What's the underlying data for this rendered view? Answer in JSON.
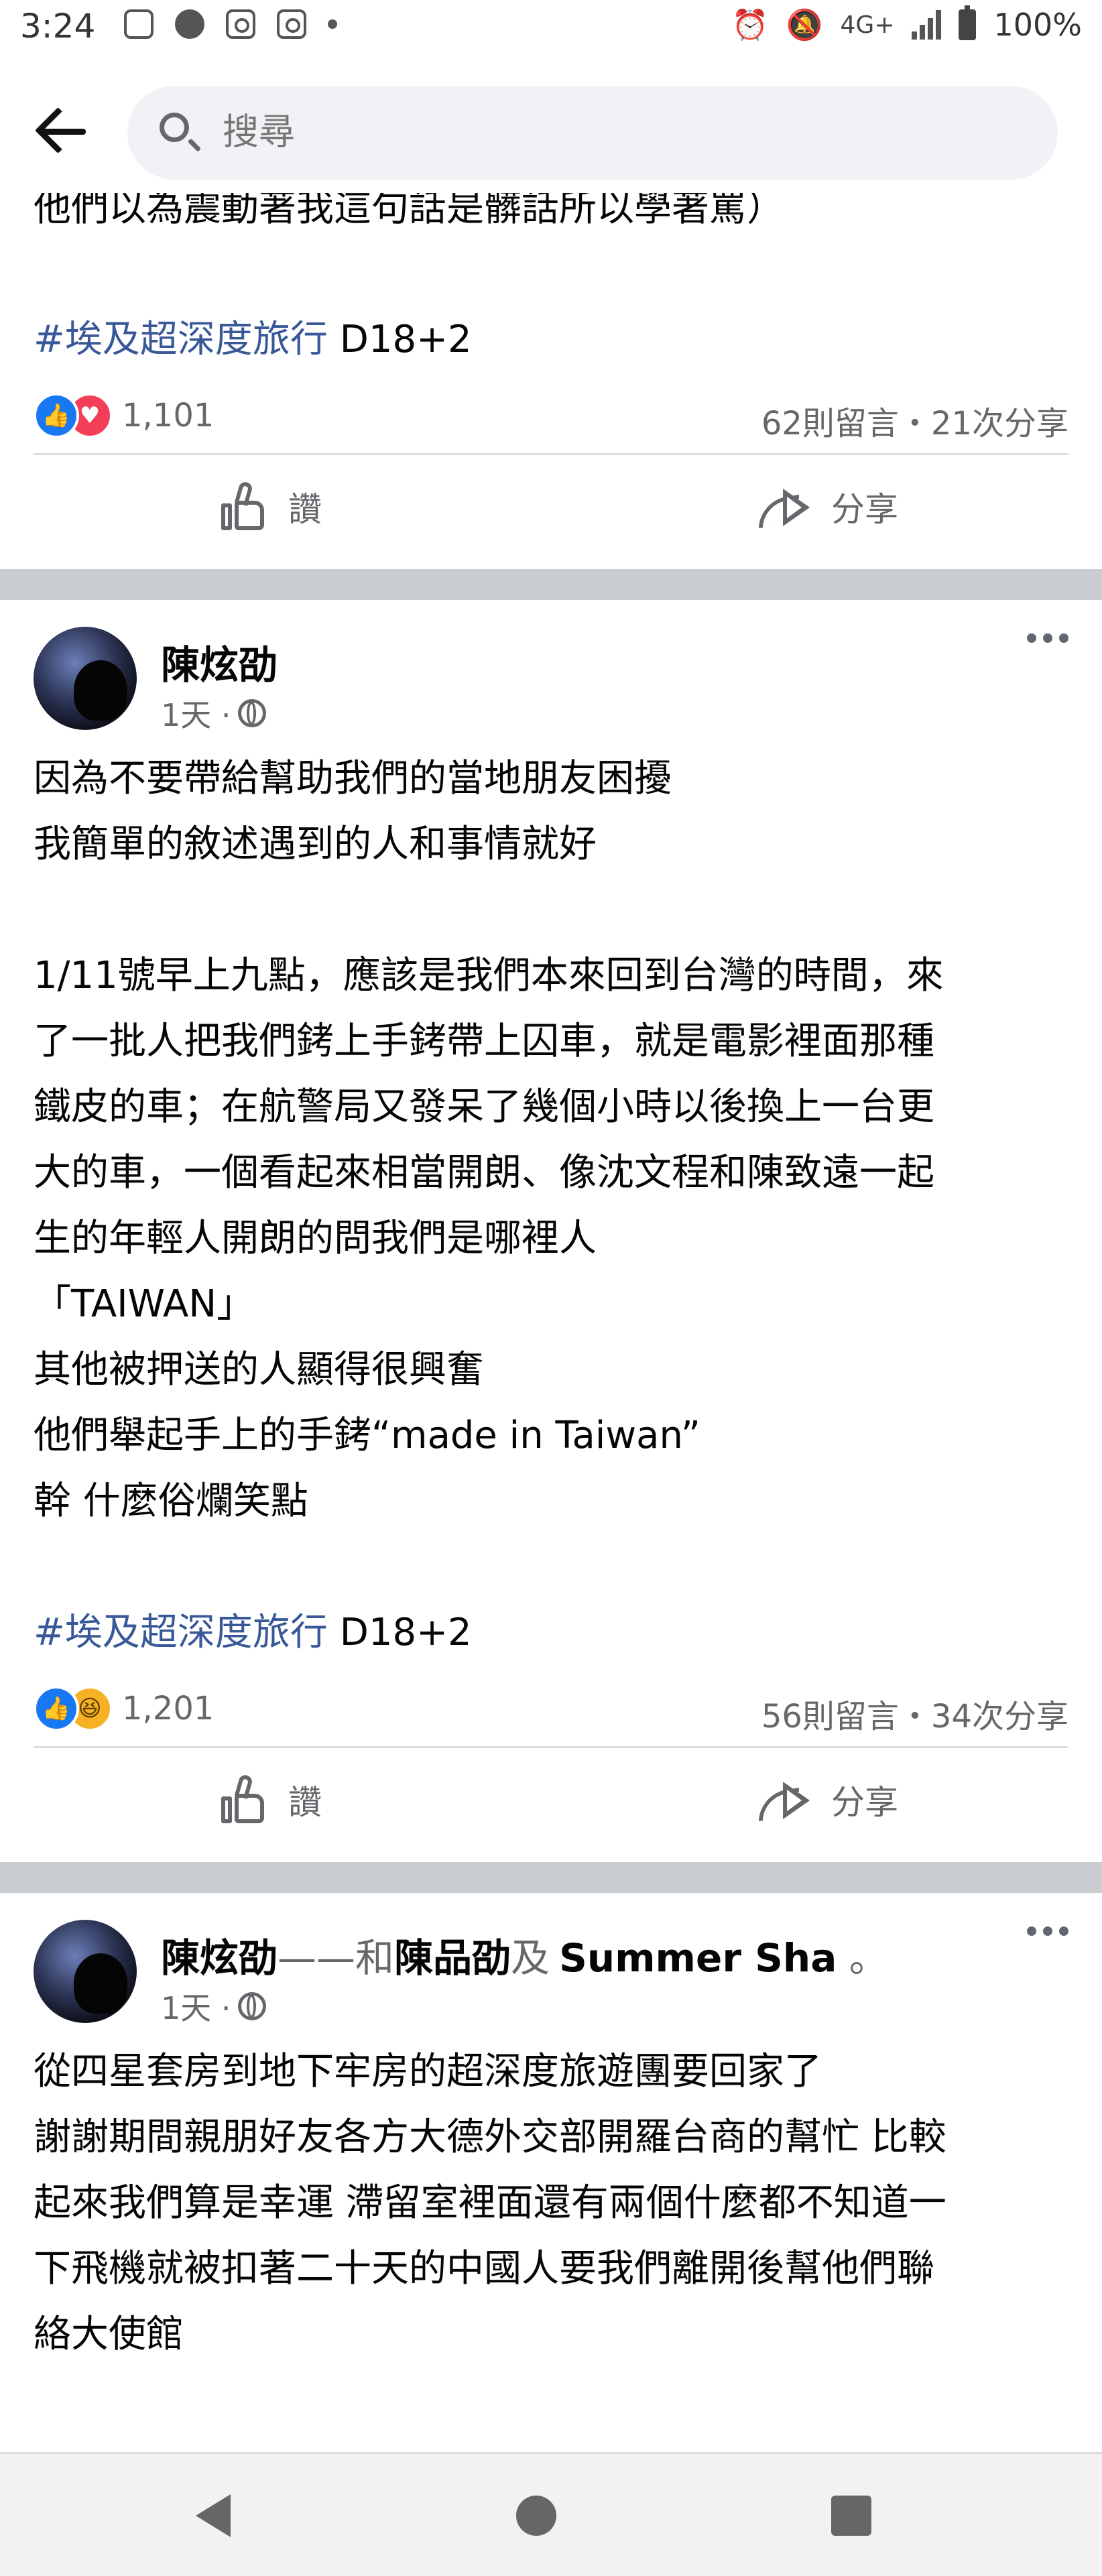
{
  "status_bar": {
    "time": "3:24",
    "network": "4G+",
    "battery": "100%"
  },
  "search": {
    "placeholder": "搜尋"
  },
  "posts": [
    {
      "text_lines": [
        "他們以為震動著我這句話是髒話所以學著罵）",
        ""
      ],
      "hashtag": "#埃及超深度旅行",
      "hashtag_suffix": " D18+2",
      "reaction_count": "1,101",
      "reactions": [
        "like",
        "love"
      ],
      "stats": "62則留言・21次分享",
      "like_label": "讚",
      "share_label": "分享"
    },
    {
      "author": "陳炫劭",
      "time": "1天 ·",
      "text_lines": [
        "因為不要帶給幫助我們的當地朋友困擾",
        "我簡單的敘述遇到的人和事情就好",
        "",
        "1/11號早上九點，應該是我們本來回到台灣的時間，來",
        "了一批人把我們銬上手銬帶上囚車，就是電影裡面那種",
        "鐵皮的車；在航警局又發呆了幾個小時以後換上一台更",
        "大的車，一個看起來相當開朗、像沈文程和陳致遠一起",
        "生的年輕人開朗的問我們是哪裡人",
        "「TAIWAN」",
        "其他被押送的人顯得很興奮",
        "他們舉起手上的手銬“made in Taiwan”",
        "幹 什麼俗爛笑點",
        ""
      ],
      "hashtag": "#埃及超深度旅行",
      "hashtag_suffix": " D18+2",
      "reaction_count": "1,201",
      "reactions": [
        "like",
        "haha"
      ],
      "stats": "56則留言・34次分享",
      "like_label": "讚",
      "share_label": "分享"
    },
    {
      "author": "陳炫劭",
      "with_text": "——和",
      "tagged_1": "陳品劭",
      "and_text": "及",
      "tagged_2": "Summer Sha",
      "end_text": " 。",
      "time": "1天 ·",
      "text_lines": [
        "從四星套房到地下牢房的超深度旅遊團要回家了",
        "謝謝期間親朋好友各方大德外交部開羅台商的幫忙 比較",
        "起來我們算是幸運 滯留室裡面還有兩個什麼都不知道一",
        "下飛機就被扣著二十天的中國人要我們離開後幫他們聯",
        "絡大使館"
      ]
    }
  ]
}
